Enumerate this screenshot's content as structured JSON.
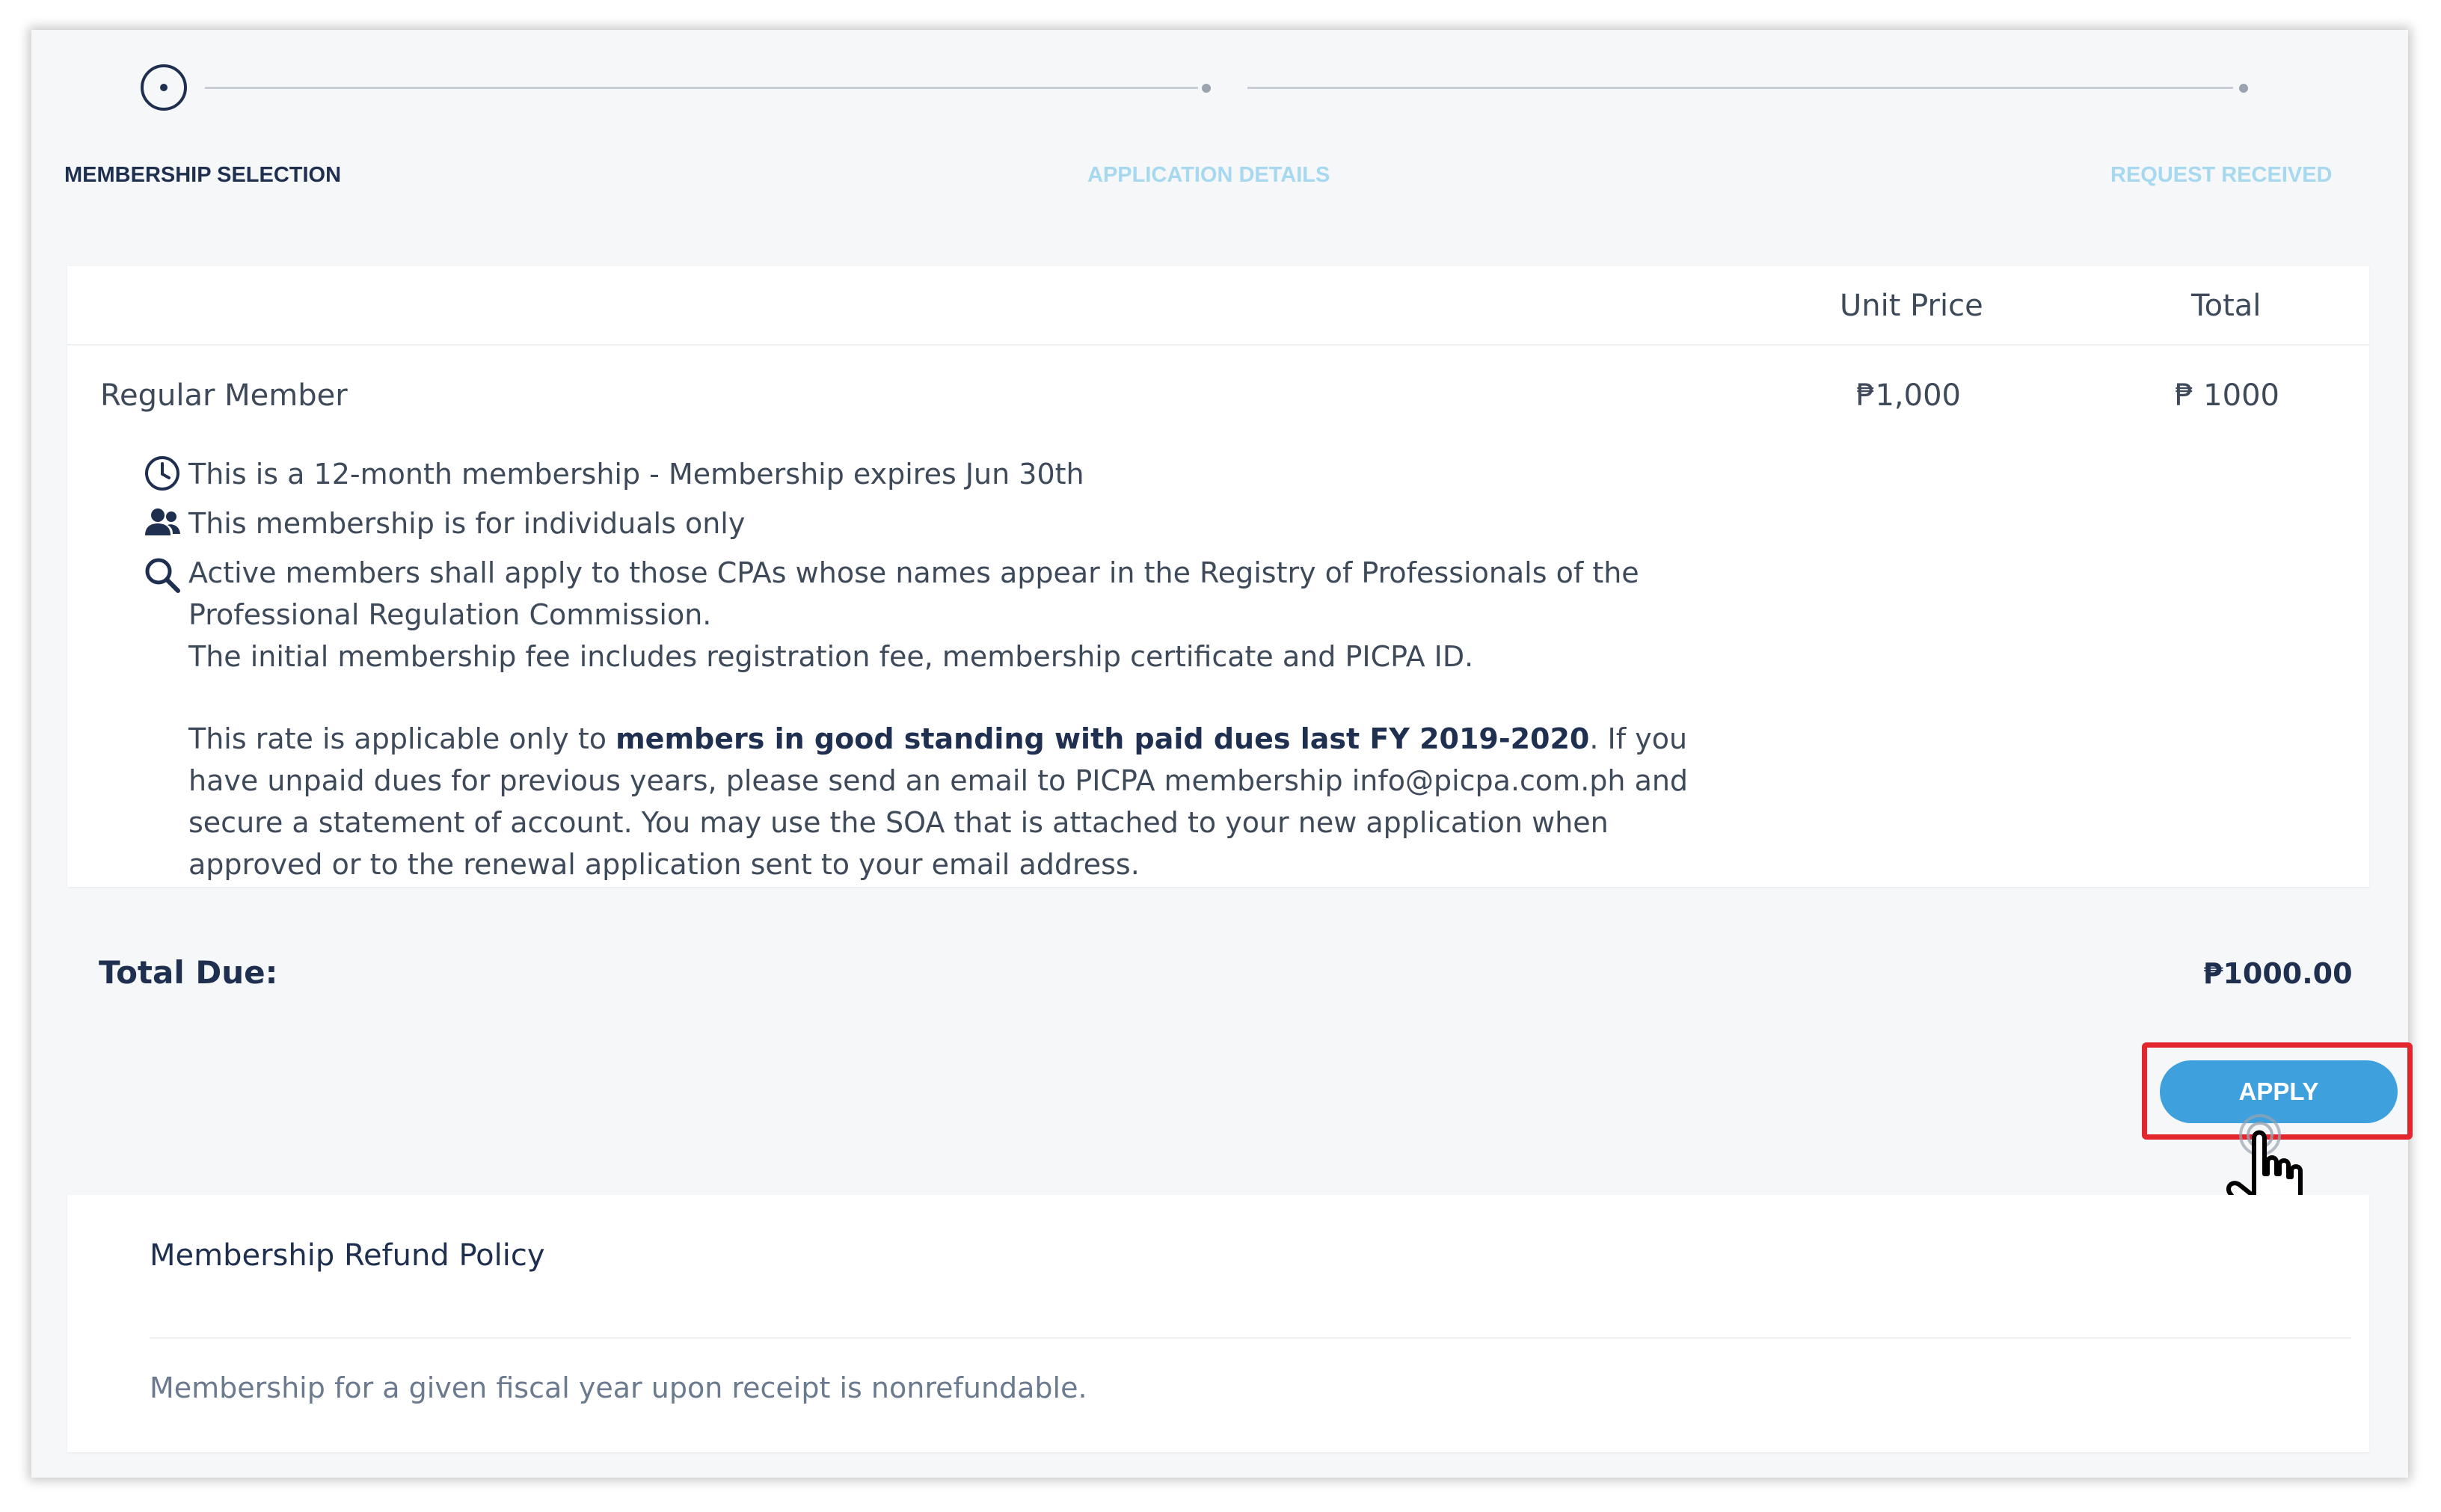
{
  "stepper": {
    "steps": [
      {
        "label": "MEMBERSHIP SELECTION",
        "state": "current"
      },
      {
        "label": "APPLICATION DETAILS",
        "state": "pending"
      },
      {
        "label": "REQUEST RECEIVED",
        "state": "pending"
      }
    ]
  },
  "table": {
    "headers": {
      "unit_price": "Unit Price",
      "total": "Total"
    },
    "item": {
      "name": "Regular Member",
      "unit_price": "₱1,000",
      "total": "₱ 1000"
    },
    "features": {
      "duration": "This is a 12-month membership - Membership expires Jun 30th",
      "individuals": "This membership is for individuals only",
      "active_line1": "Active members shall apply to those CPAs whose names appear in the Registry of Professionals of the",
      "active_line2": "Professional Regulation Commission.",
      "active_line3": "The initial membership fee includes registration fee, membership certificate and PICPA ID.",
      "rate_prefix": "This rate is applicable only to ",
      "rate_bold": "members in good standing with paid dues last FY 2019-2020",
      "rate_suffix": ". If you",
      "rate_line2": "have unpaid dues for previous years, please send an email to PICPA membership info@picpa.com.ph  and",
      "rate_line3": "secure a statement of account. You may use the SOA that is attached to your new application when",
      "rate_line4": "approved or to the renewal application sent to your email address."
    },
    "icons": [
      "clock-icon",
      "users-icon",
      "search-icon"
    ]
  },
  "total_due": {
    "label": "Total Due:",
    "value": "₱1000.00"
  },
  "apply_button": {
    "label": "APPLY"
  },
  "refund_policy": {
    "title": "Membership Refund Policy",
    "text": "Membership for a given fiscal year upon receipt is nonrefundable."
  },
  "colors": {
    "accent": "#3fa0de",
    "highlight": "#e3262e",
    "navy": "#1e2f4f",
    "pending_step": "#a6d8ef"
  }
}
